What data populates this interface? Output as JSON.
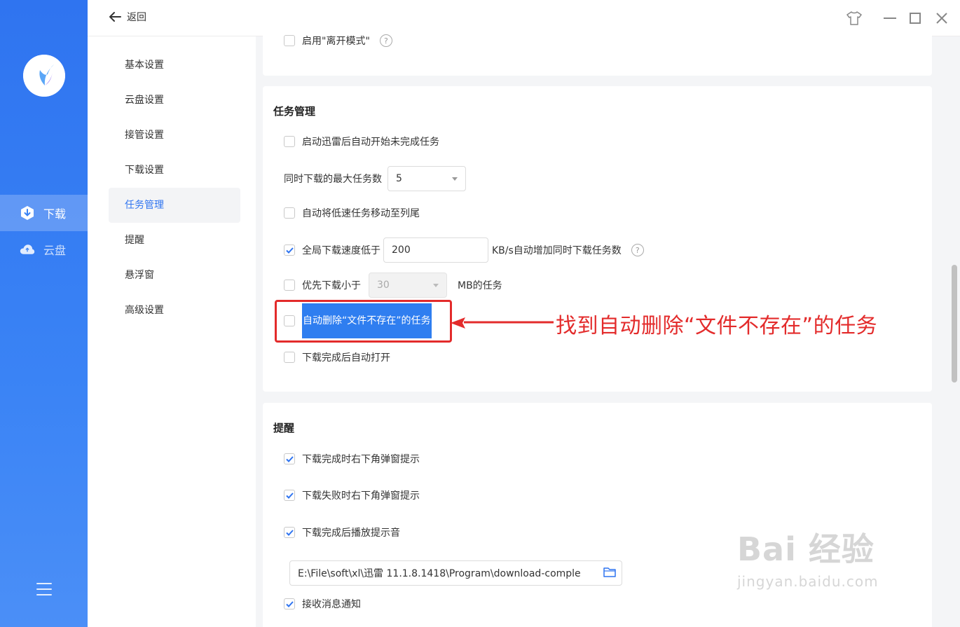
{
  "topbar": {
    "back_label": "返回"
  },
  "rail": {
    "items": [
      {
        "label": "下载",
        "icon": "download-shield-icon"
      },
      {
        "label": "云盘",
        "icon": "cloud-icon"
      }
    ]
  },
  "nav": {
    "items": [
      {
        "label": "基本设置"
      },
      {
        "label": "云盘设置"
      },
      {
        "label": "接管设置"
      },
      {
        "label": "下载设置"
      },
      {
        "label": "任务管理"
      },
      {
        "label": "提醒"
      },
      {
        "label": "悬浮窗"
      },
      {
        "label": "高级设置"
      }
    ]
  },
  "top_card": {
    "away_mode_label": "启用\"离开模式\""
  },
  "task_mgmt": {
    "title": "任务管理",
    "auto_start_label": "启动迅雷后自动开始未完成任务",
    "max_tasks_label": "同时下载的最大任务数",
    "max_tasks_value": "5",
    "move_slow_label": "自动将低速任务移动至列尾",
    "speed_prefix": "全局下载速度低于",
    "speed_value": "200",
    "speed_suffix": "KB/s自动增加同时下载任务数",
    "small_first_prefix": "优先下载小于",
    "small_first_value": "30",
    "small_first_suffix": "MB的任务",
    "auto_delete_label": "自动删除“文件不存在”的任务",
    "auto_open_label": "下载完成后自动打开"
  },
  "reminder": {
    "title": "提醒",
    "done_popup_label": "下载完成时右下角弹窗提示",
    "fail_popup_label": "下载失败时右下角弹窗提示",
    "done_sound_label": "下载完成后播放提示音",
    "sound_path": "E:\\File\\soft\\xl\\迅雷 11.1.8.1418\\Program\\download-comple",
    "receive_notice_label": "接收消息通知"
  },
  "annotation": {
    "text": "找到自动删除“文件不存在”的任务",
    "color": "#e32b2b"
  },
  "watermark": {
    "line1": "Bai 经验",
    "line2": "jingyan.baidu.com"
  },
  "colors": {
    "accent": "#2f74f0",
    "rail_bg": "#3a83f5"
  }
}
